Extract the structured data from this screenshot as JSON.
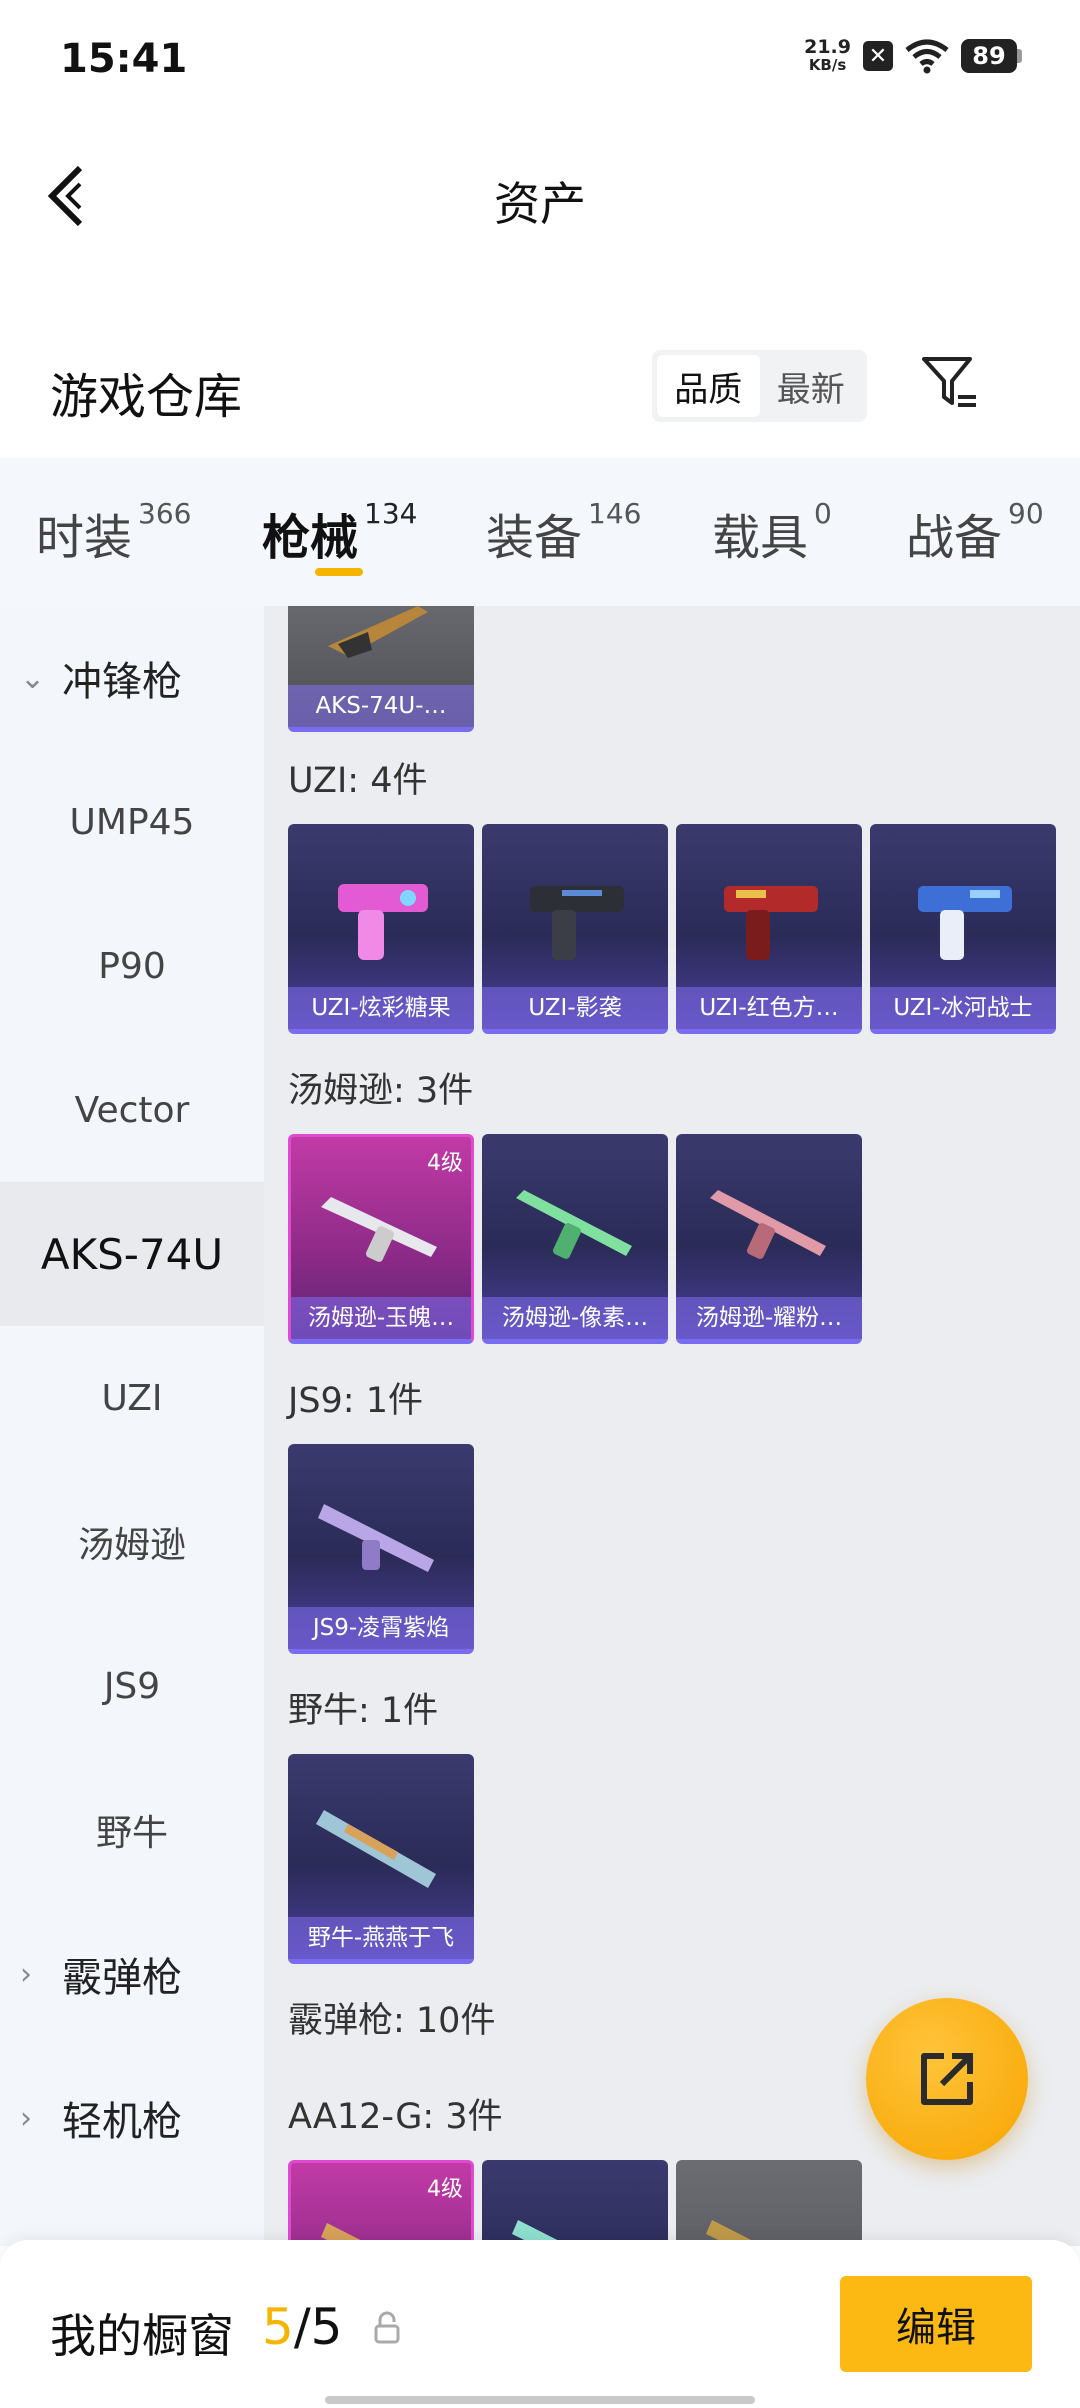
{
  "status": {
    "time": "15:41",
    "net_speed": "21.9",
    "net_unit": "KB/s",
    "battery": "89"
  },
  "header": {
    "title": "资产"
  },
  "warehouse": {
    "title": "游戏仓库",
    "sort": {
      "quality": "品质",
      "latest": "最新",
      "active": "quality"
    }
  },
  "tabs": [
    {
      "label": "时装",
      "count": "366"
    },
    {
      "label": "枪械",
      "count": "134",
      "active": true
    },
    {
      "label": "装备",
      "count": "146"
    },
    {
      "label": "载具",
      "count": "0"
    },
    {
      "label": "战备",
      "count": "90"
    }
  ],
  "sidebar": {
    "groups": {
      "smg": "冲锋枪",
      "shotgun": "霰弹枪",
      "lmg": "轻机枪"
    },
    "items": [
      "UMP45",
      "P90",
      "Vector",
      "AKS-74U",
      "UZI",
      "汤姆逊",
      "JS9",
      "野牛"
    ],
    "selected": "AKS-74U"
  },
  "content": {
    "aks": {
      "card": "AKS-74U-…"
    },
    "uzi": {
      "label": "UZI: 4件",
      "cards": [
        "UZI-炫彩糖果",
        "UZI-影袭",
        "UZI-红色方…",
        "UZI-冰河战士"
      ]
    },
    "thompson": {
      "label": "汤姆逊: 3件",
      "cards": [
        "汤姆逊-玉魄…",
        "汤姆逊-像素…",
        "汤姆逊-耀粉…"
      ],
      "level": "4级"
    },
    "js9": {
      "label": "JS9: 1件",
      "cards": [
        "JS9-凌霄紫焰"
      ]
    },
    "bison": {
      "label": "野牛: 1件",
      "cards": [
        "野牛-燕燕于飞"
      ]
    },
    "shotgun_label": "霰弹枪: 10件",
    "aa12": {
      "label": "AA12-G: 3件",
      "level": "4级"
    }
  },
  "bottom": {
    "showcase_label": "我的橱窗",
    "showcase_current": "5",
    "showcase_total": "/5",
    "edit": "编辑"
  },
  "colors": {
    "accent": "#f5b400",
    "card_purple": "#2b2b58",
    "card_gold": "#c23aa6"
  }
}
